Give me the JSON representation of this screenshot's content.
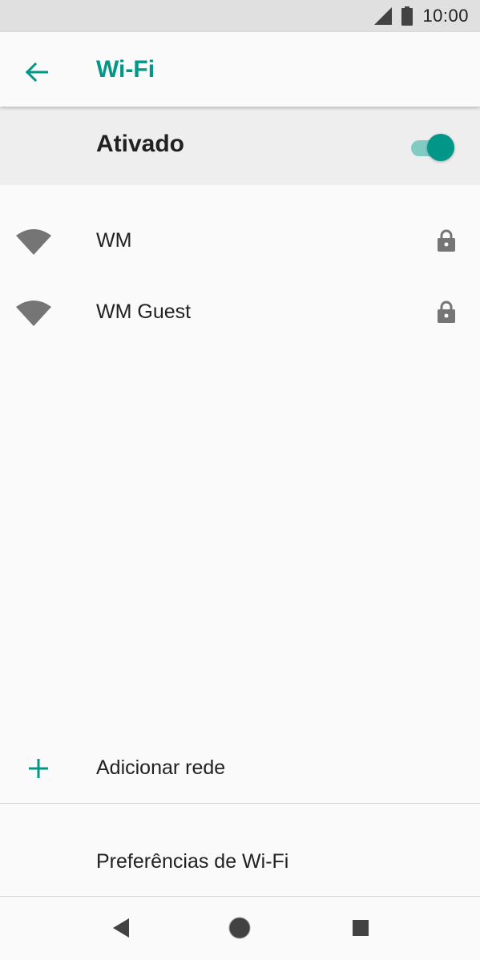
{
  "status_bar": {
    "time": "10:00",
    "icons": [
      "cell-signal-icon",
      "battery-icon"
    ]
  },
  "app_bar": {
    "back_icon": "arrow-back-icon",
    "title": "Wi-Fi"
  },
  "master_switch": {
    "label": "Ativado",
    "state": "on"
  },
  "networks": [
    {
      "name": "WM",
      "icon": "wifi-signal-icon",
      "secured_icon": "lock-icon"
    },
    {
      "name": "WM Guest",
      "icon": "wifi-signal-icon",
      "secured_icon": "lock-icon"
    }
  ],
  "actions": {
    "add_network": {
      "icon": "plus-icon",
      "label": "Adicionar rede"
    },
    "preferences": {
      "label": "Preferências de Wi-Fi"
    }
  },
  "nav_bar": {
    "buttons": [
      "back-triangle-icon",
      "home-circle-icon",
      "recents-square-icon"
    ]
  },
  "colors": {
    "accent": "#009688",
    "accent_light": "#80cbc4",
    "text_primary": "#212121",
    "icon_gray": "#757575",
    "status_bar_bg": "#e0e0e0",
    "master_row_bg": "#eeeeee",
    "background": "#fafafa"
  }
}
